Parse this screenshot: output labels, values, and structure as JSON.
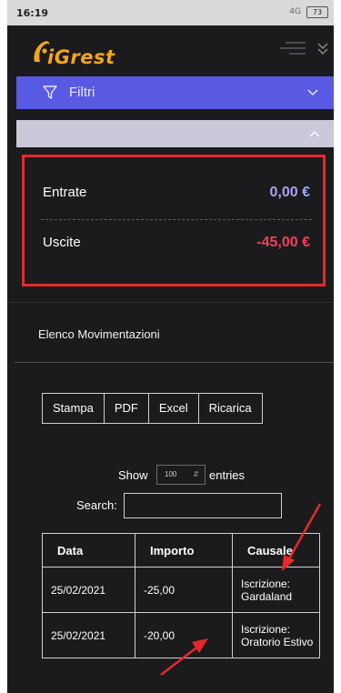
{
  "status_bar": {
    "time": "16:19",
    "signal": "4G",
    "battery": "73"
  },
  "header": {
    "logo_text": "iGrest"
  },
  "filter": {
    "label": "Filtri"
  },
  "summary": {
    "entrate_label": "Entrate",
    "entrate_value": "0,00 €",
    "uscite_label": "Uscite",
    "uscite_value": "-45,00 €"
  },
  "movimentazioni": {
    "title": "Elenco Movimentazioni",
    "buttons": [
      "Stampa",
      "PDF",
      "Excel",
      "Ricarica"
    ],
    "show_label": "Show",
    "entries_value": "100",
    "entries_label": "entries",
    "search_label": "Search:",
    "search_value": "",
    "table": {
      "headers": [
        "Data",
        "Importo",
        "Causale"
      ],
      "rows": [
        [
          "25/02/2021",
          "-25,00",
          "Iscrizione: Gardaland"
        ],
        [
          "25/02/2021",
          "-20,00",
          "Iscrizione: Oratorio Estivo"
        ]
      ]
    }
  },
  "colors": {
    "accent": "#5a59e2",
    "highlight_border": "#e5292a",
    "entrate": "#a6a5f5",
    "uscite": "#f0415a",
    "logo": "#f4a51c"
  }
}
